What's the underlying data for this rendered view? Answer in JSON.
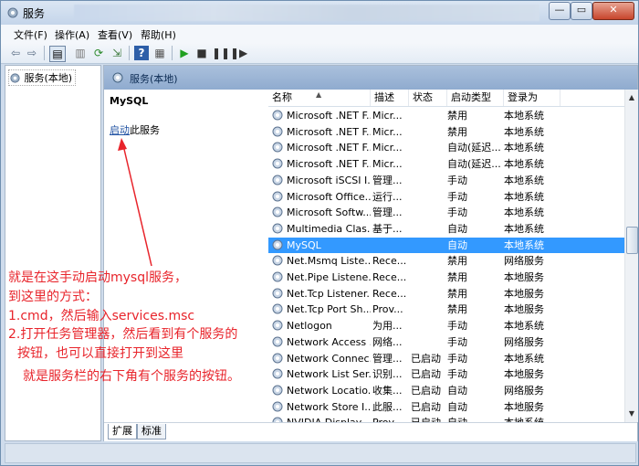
{
  "window": {
    "title": "服务",
    "minimize": "—",
    "maximize": "▭",
    "close": "✕"
  },
  "menu": [
    "文件(F)",
    "操作(A)",
    "查看(V)",
    "帮助(H)"
  ],
  "tree": {
    "root_label": "服务(本地)"
  },
  "pane": {
    "header_title": "服务(本地)"
  },
  "detail": {
    "service_name": "MySQL",
    "start_link": "启动",
    "start_suffix": "此服务"
  },
  "columns": {
    "name": "名称",
    "description": "描述",
    "status": "状态",
    "startup_type": "启动类型",
    "log_on_as": "登录为"
  },
  "services": [
    {
      "name": "Microsoft .NET F...",
      "description": "Micr...",
      "status": "",
      "startup": "禁用",
      "logon": "本地系统"
    },
    {
      "name": "Microsoft .NET F...",
      "description": "Micr...",
      "status": "",
      "startup": "禁用",
      "logon": "本地系统"
    },
    {
      "name": "Microsoft .NET F...",
      "description": "Micr...",
      "status": "",
      "startup": "自动(延迟...",
      "logon": "本地系统"
    },
    {
      "name": "Microsoft .NET F...",
      "description": "Micr...",
      "status": "",
      "startup": "自动(延迟...",
      "logon": "本地系统"
    },
    {
      "name": "Microsoft iSCSI I...",
      "description": "管理...",
      "status": "",
      "startup": "手动",
      "logon": "本地系统"
    },
    {
      "name": "Microsoft Office...",
      "description": "运行...",
      "status": "",
      "startup": "手动",
      "logon": "本地系统"
    },
    {
      "name": "Microsoft Softw...",
      "description": "管理...",
      "status": "",
      "startup": "手动",
      "logon": "本地系统"
    },
    {
      "name": "Multimedia Clas...",
      "description": "基于...",
      "status": "",
      "startup": "自动",
      "logon": "本地系统"
    },
    {
      "name": "MySQL",
      "description": "",
      "status": "",
      "startup": "自动",
      "logon": "本地系统",
      "selected": true
    },
    {
      "name": "Net.Msmq Liste...",
      "description": "Rece...",
      "status": "",
      "startup": "禁用",
      "logon": "网络服务"
    },
    {
      "name": "Net.Pipe Listene...",
      "description": "Rece...",
      "status": "",
      "startup": "禁用",
      "logon": "本地服务"
    },
    {
      "name": "Net.Tcp Listener...",
      "description": "Rece...",
      "status": "",
      "startup": "禁用",
      "logon": "本地服务"
    },
    {
      "name": "Net.Tcp Port Sh...",
      "description": "Prov...",
      "status": "",
      "startup": "禁用",
      "logon": "本地服务"
    },
    {
      "name": "Netlogon",
      "description": "为用...",
      "status": "",
      "startup": "手动",
      "logon": "本地系统"
    },
    {
      "name": "Network Access ...",
      "description": "网络...",
      "status": "",
      "startup": "手动",
      "logon": "网络服务"
    },
    {
      "name": "Network Connec...",
      "description": "管理...",
      "status": "已启动",
      "startup": "手动",
      "logon": "本地系统"
    },
    {
      "name": "Network List Ser...",
      "description": "识别...",
      "status": "已启动",
      "startup": "手动",
      "logon": "本地服务"
    },
    {
      "name": "Network Locatio...",
      "description": "收集...",
      "status": "已启动",
      "startup": "自动",
      "logon": "网络服务"
    },
    {
      "name": "Network Store I...",
      "description": "此服...",
      "status": "已启动",
      "startup": "自动",
      "logon": "本地服务"
    },
    {
      "name": "NVIDIA Display ...",
      "description": "Prov...",
      "status": "已启动",
      "startup": "自动",
      "logon": "本地系统"
    }
  ],
  "tabs": [
    "扩展",
    "标准"
  ],
  "annotation": {
    "lines": [
      "就是在这手动启动mysql服务，",
      "到这里的方式：",
      "1.cmd，然后输入services.msc",
      "2.打开任务管理器，然后看到有个服务的",
      "按钮，也可以直接打开到这里",
      "就是服务栏的右下角有个服务的按钮。"
    ],
    "color": "#e8242b"
  },
  "colors": {
    "selection": "#3399ff",
    "pane_header": "#9db6d7",
    "annotation": "#e8242b"
  }
}
